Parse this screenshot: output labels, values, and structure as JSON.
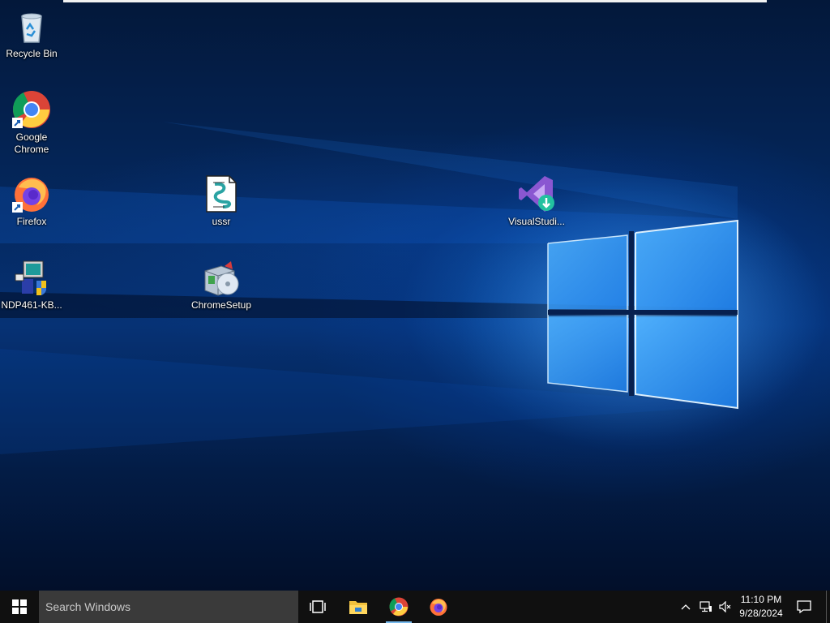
{
  "desktop": {
    "icons": [
      {
        "label": "Recycle Bin",
        "icon": "recycle-bin-icon"
      },
      {
        "label": "Google Chrome",
        "icon": "chrome-icon"
      },
      {
        "label": "Firefox",
        "icon": "firefox-icon"
      },
      {
        "label": "NDP461-KB...",
        "icon": "installer-icon"
      },
      {
        "label": "ussr",
        "icon": "script-file-icon"
      },
      {
        "label": "ChromeSetup",
        "icon": "setup-package-icon"
      },
      {
        "label": "VisualStudi...",
        "icon": "visual-studio-installer-icon"
      }
    ]
  },
  "taskbar": {
    "search_placeholder": "Search Windows",
    "pinned": [
      "task-view-icon",
      "file-explorer-icon",
      "chrome-icon",
      "firefox-icon"
    ],
    "clock": {
      "time": "11:10 PM",
      "date": "9/28/2024"
    },
    "tray": [
      "chevron-up-icon",
      "network-icon",
      "volume-muted-icon",
      "notification-icon"
    ]
  },
  "colors": {
    "taskbar": "#101010",
    "search_box": "#3a3a3a",
    "accent": "#1e8cff"
  }
}
